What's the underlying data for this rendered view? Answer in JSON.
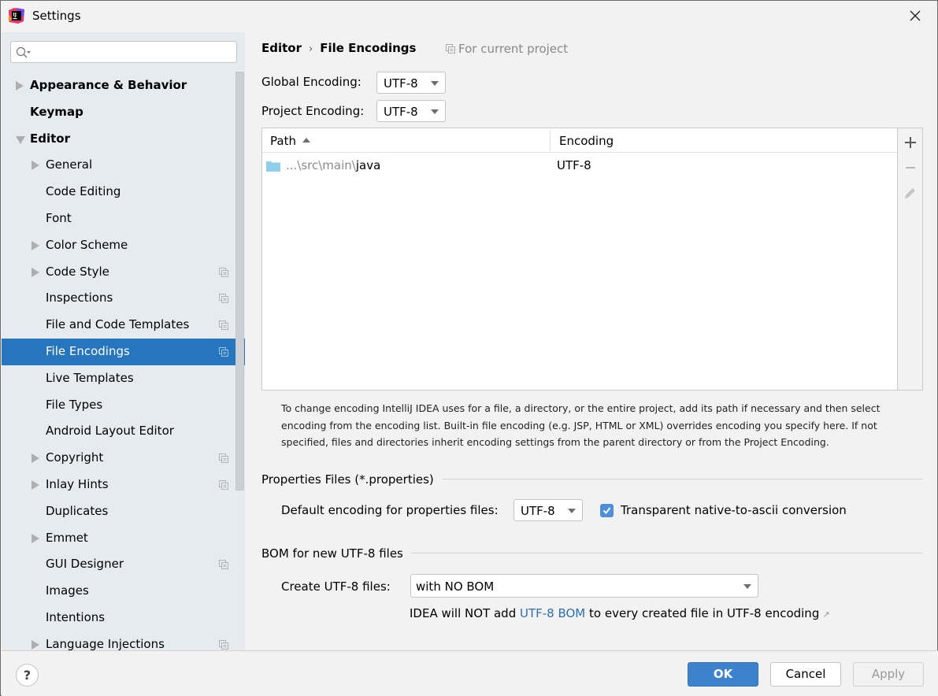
{
  "window": {
    "title": "Settings",
    "app_icon": "intellij-idea-icon"
  },
  "sidebar": {
    "search": {
      "value": "",
      "placeholder": ""
    },
    "items": [
      {
        "label": "Appearance & Behavior",
        "level": 0,
        "bold": true,
        "expander": "collapsed",
        "project_scope": false
      },
      {
        "label": "Keymap",
        "level": 0,
        "bold": true,
        "expander": "none",
        "project_scope": false
      },
      {
        "label": "Editor",
        "level": 0,
        "bold": true,
        "expander": "expanded",
        "project_scope": false
      },
      {
        "label": "General",
        "level": 1,
        "bold": false,
        "expander": "collapsed",
        "project_scope": false
      },
      {
        "label": "Code Editing",
        "level": 1,
        "bold": false,
        "expander": "none",
        "project_scope": false
      },
      {
        "label": "Font",
        "level": 1,
        "bold": false,
        "expander": "none",
        "project_scope": false
      },
      {
        "label": "Color Scheme",
        "level": 1,
        "bold": false,
        "expander": "collapsed",
        "project_scope": false
      },
      {
        "label": "Code Style",
        "level": 1,
        "bold": false,
        "expander": "collapsed",
        "project_scope": true
      },
      {
        "label": "Inspections",
        "level": 1,
        "bold": false,
        "expander": "none",
        "project_scope": true
      },
      {
        "label": "File and Code Templates",
        "level": 1,
        "bold": false,
        "expander": "none",
        "project_scope": true
      },
      {
        "label": "File Encodings",
        "level": 1,
        "bold": false,
        "expander": "none",
        "project_scope": true,
        "selected": true
      },
      {
        "label": "Live Templates",
        "level": 1,
        "bold": false,
        "expander": "none",
        "project_scope": false
      },
      {
        "label": "File Types",
        "level": 1,
        "bold": false,
        "expander": "none",
        "project_scope": false
      },
      {
        "label": "Android Layout Editor",
        "level": 1,
        "bold": false,
        "expander": "none",
        "project_scope": false
      },
      {
        "label": "Copyright",
        "level": 1,
        "bold": false,
        "expander": "collapsed",
        "project_scope": true
      },
      {
        "label": "Inlay Hints",
        "level": 1,
        "bold": false,
        "expander": "collapsed",
        "project_scope": true
      },
      {
        "label": "Duplicates",
        "level": 1,
        "bold": false,
        "expander": "none",
        "project_scope": false
      },
      {
        "label": "Emmet",
        "level": 1,
        "bold": false,
        "expander": "collapsed",
        "project_scope": false
      },
      {
        "label": "GUI Designer",
        "level": 1,
        "bold": false,
        "expander": "none",
        "project_scope": true
      },
      {
        "label": "Images",
        "level": 1,
        "bold": false,
        "expander": "none",
        "project_scope": false
      },
      {
        "label": "Intentions",
        "level": 1,
        "bold": false,
        "expander": "none",
        "project_scope": false
      },
      {
        "label": "Language Injections",
        "level": 1,
        "bold": false,
        "expander": "collapsed",
        "project_scope": true
      }
    ]
  },
  "content": {
    "breadcrumb": [
      "Editor",
      "File Encodings"
    ],
    "breadcrumb_separator": "›",
    "scope_note": "For current project",
    "global_encoding": {
      "label": "Global Encoding:",
      "value": "UTF-8"
    },
    "project_encoding": {
      "label": "Project Encoding:",
      "value": "UTF-8"
    },
    "table": {
      "columns": [
        "Path",
        "Encoding"
      ],
      "sort": {
        "column": "Path",
        "direction": "ascending"
      },
      "rows": [
        {
          "path_prefix": "...\\src\\main\\",
          "path_name": "java",
          "encoding": "UTF-8",
          "icon": "folder-icon"
        }
      ],
      "toolbar": [
        "add",
        "remove",
        "edit"
      ]
    },
    "help_text": "To change encoding IntelliJ IDEA uses for a file, a directory, or the entire project, add its path if necessary and then select encoding from the encoding list. Built-in file encoding (e.g. JSP, HTML or XML) overrides encoding you specify here. If not specified, files and directories inherit encoding settings from the parent directory or from the Project Encoding.",
    "properties": {
      "title": "Properties Files (*.properties)",
      "default_label": "Default encoding for properties files:",
      "default_value": "UTF-8",
      "native_to_ascii_label": "Transparent native-to-ascii conversion",
      "native_to_ascii_checked": true
    },
    "bom": {
      "title": "BOM for new UTF-8 files",
      "create_label": "Create UTF-8 files:",
      "create_value": "with NO BOM",
      "note_before": "IDEA will NOT add ",
      "note_link": "UTF-8 BOM",
      "note_after": " to every created file in UTF-8 encoding",
      "note_arrow": "↗"
    }
  },
  "footer": {
    "help": "?",
    "ok": "OK",
    "cancel": "Cancel",
    "apply": "Apply",
    "apply_enabled": false
  },
  "colors": {
    "selection": "#2675bf",
    "primary_button": "#3c82cc",
    "link": "#2d6fb3",
    "checkbox": "#4d8fd8",
    "sidebar_bg": "#e6ebf0"
  }
}
